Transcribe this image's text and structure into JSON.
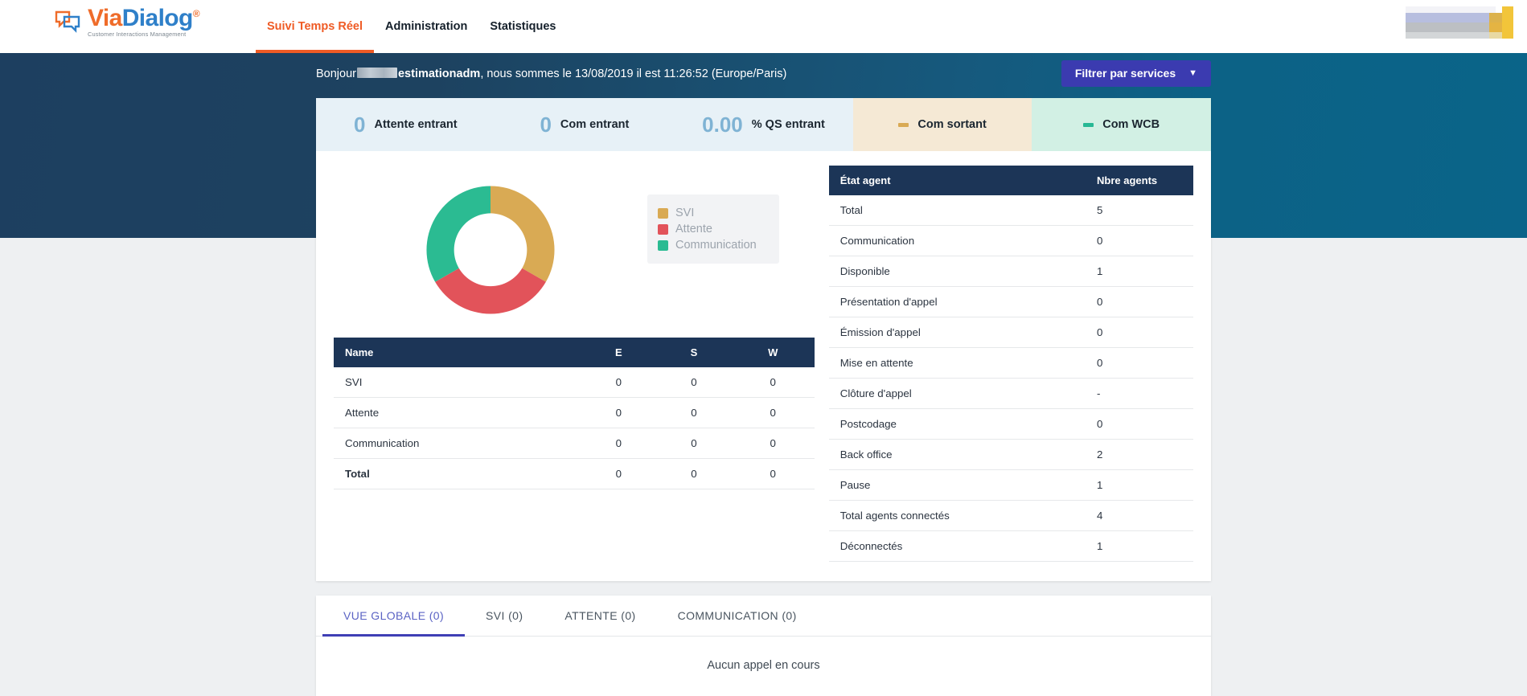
{
  "brand": {
    "name_part1": "Via",
    "name_part2": "Dialog",
    "registered": "®",
    "tagline": "Customer Interactions Management"
  },
  "nav": {
    "items": [
      {
        "label": "Suivi Temps Réel",
        "active": true
      },
      {
        "label": "Administration",
        "active": false
      },
      {
        "label": "Statistiques",
        "active": false
      }
    ],
    "accent_color": "#ef5b25"
  },
  "hero": {
    "greeting_prefix": "Bonjour ",
    "greeting_user": "estimationadm",
    "greeting_suffix": ", nous sommes le 13/08/2019 il est 11:26:52 (Europe/Paris)",
    "date": "13/08/2019",
    "time": "11:26:52",
    "timezone": "Europe/Paris",
    "filter_button": "Filtrer par services",
    "filter_chevron": "chevron-down-icon",
    "filter_button_color": "#3b3bb0"
  },
  "kpis": [
    {
      "value": "0",
      "label": "Attente entrant",
      "style": "plain"
    },
    {
      "value": "0",
      "label": "Com entrant",
      "style": "plain"
    },
    {
      "value": "0.00",
      "label": "% QS entrant",
      "style": "plain"
    },
    {
      "value": "",
      "label": "Com sortant",
      "style": "sortant",
      "dash_color": "#d9aa54"
    },
    {
      "value": "",
      "label": "Com WCB",
      "style": "wcb",
      "dash_color": "#27b894"
    }
  ],
  "chart_data": {
    "type": "pie",
    "title": "",
    "labels": [
      "SVI",
      "Attente",
      "Communication"
    ],
    "values": [
      33.3,
      33.3,
      33.4
    ],
    "colors": [
      "#d9aa54",
      "#e2535a",
      "#2bbb92"
    ],
    "donut": true,
    "legend_position": "right"
  },
  "left_table": {
    "columns": [
      "Name",
      "E",
      "S",
      "W"
    ],
    "rows": [
      {
        "name": "SVI",
        "e": "0",
        "s": "0",
        "w": "0"
      },
      {
        "name": "Attente",
        "e": "0",
        "s": "0",
        "w": "0"
      },
      {
        "name": "Communication",
        "e": "0",
        "s": "0",
        "w": "0"
      },
      {
        "name": "Total",
        "e": "0",
        "s": "0",
        "w": "0"
      }
    ]
  },
  "agent_table": {
    "columns": [
      "État agent",
      "Nbre agents"
    ],
    "rows": [
      {
        "state": "Total",
        "count": "5"
      },
      {
        "state": "Communication",
        "count": "0"
      },
      {
        "state": "Disponible",
        "count": "1"
      },
      {
        "state": "Présentation d'appel",
        "count": "0"
      },
      {
        "state": "Émission d'appel",
        "count": "0"
      },
      {
        "state": "Mise en attente",
        "count": "0"
      },
      {
        "state": "Clôture d'appel",
        "count": "-"
      },
      {
        "state": "Postcodage",
        "count": "0"
      },
      {
        "state": "Back office",
        "count": "2"
      },
      {
        "state": "Pause",
        "count": "1"
      },
      {
        "state": "Total agents connectés",
        "count": "4"
      },
      {
        "state": "Déconnectés",
        "count": "1"
      }
    ]
  },
  "bottom": {
    "tabs": [
      {
        "label": "VUE GLOBALE (0)",
        "active": true
      },
      {
        "label": "SVI (0)",
        "active": false
      },
      {
        "label": "ATTENTE (0)",
        "active": false
      },
      {
        "label": "COMMUNICATION (0)",
        "active": false
      }
    ],
    "empty_message": "Aucun appel en cours",
    "active_tab_color": "#3f3fb5"
  }
}
